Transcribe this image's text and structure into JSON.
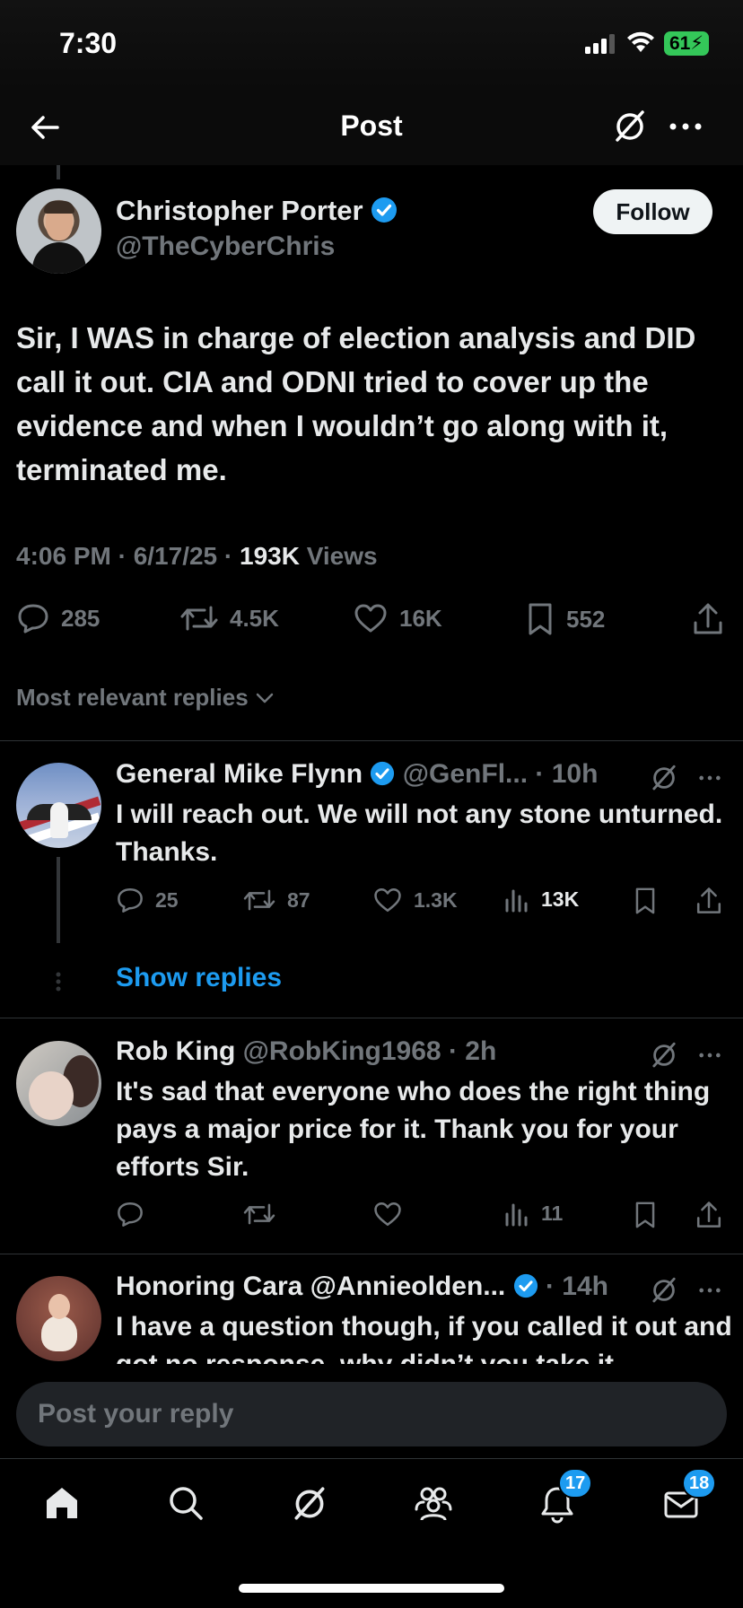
{
  "status_bar": {
    "time": "7:30",
    "battery": "61"
  },
  "nav": {
    "title": "Post"
  },
  "post": {
    "author_name": "Christopher Porter",
    "handle": "@TheCyberChris",
    "follow_label": "Follow",
    "text": "Sir, I WAS in charge of election analysis and DID call it out. CIA and ODNI tried to cover up the evidence and when I wouldn’t go along with it, terminated me.",
    "meta_time": "4:06 PM · 6/17/25 · ",
    "meta_views_count": "193K",
    "meta_views_label": " Views",
    "stats": {
      "replies": "285",
      "reposts": "4.5K",
      "likes": "16K",
      "bookmarks": "552"
    }
  },
  "sort_label": "Most relevant replies",
  "replies": [
    {
      "name": "General Mike Flynn",
      "handle_time": "@GenFl... · 10h",
      "text": "I will reach out. We will not any stone unturned. Thanks.",
      "stats": {
        "replies": "25",
        "reposts": "87",
        "likes": "1.3K",
        "views": "13K"
      },
      "show_replies": "Show replies"
    },
    {
      "name": "Rob King",
      "handle_time": "@RobKing1968 · 2h",
      "text": "It's sad that everyone who does the right thing pays a major price for it. Thank you for your efforts Sir.",
      "stats": {
        "views": "11"
      }
    },
    {
      "name": "Honoring Cara @Annieolden...",
      "handle_time": "· 14h",
      "text": "I have a question though, if you called it out and got no response, why didn’t you take it"
    }
  ],
  "composer": {
    "placeholder": "Post your reply"
  },
  "tabbar": {
    "notifications_badge": "17",
    "messages_badge": "18"
  },
  "colors": {
    "accent": "#1d9bf0",
    "muted": "#71767b",
    "text": "#e7e9ea",
    "battery": "#34c759"
  }
}
